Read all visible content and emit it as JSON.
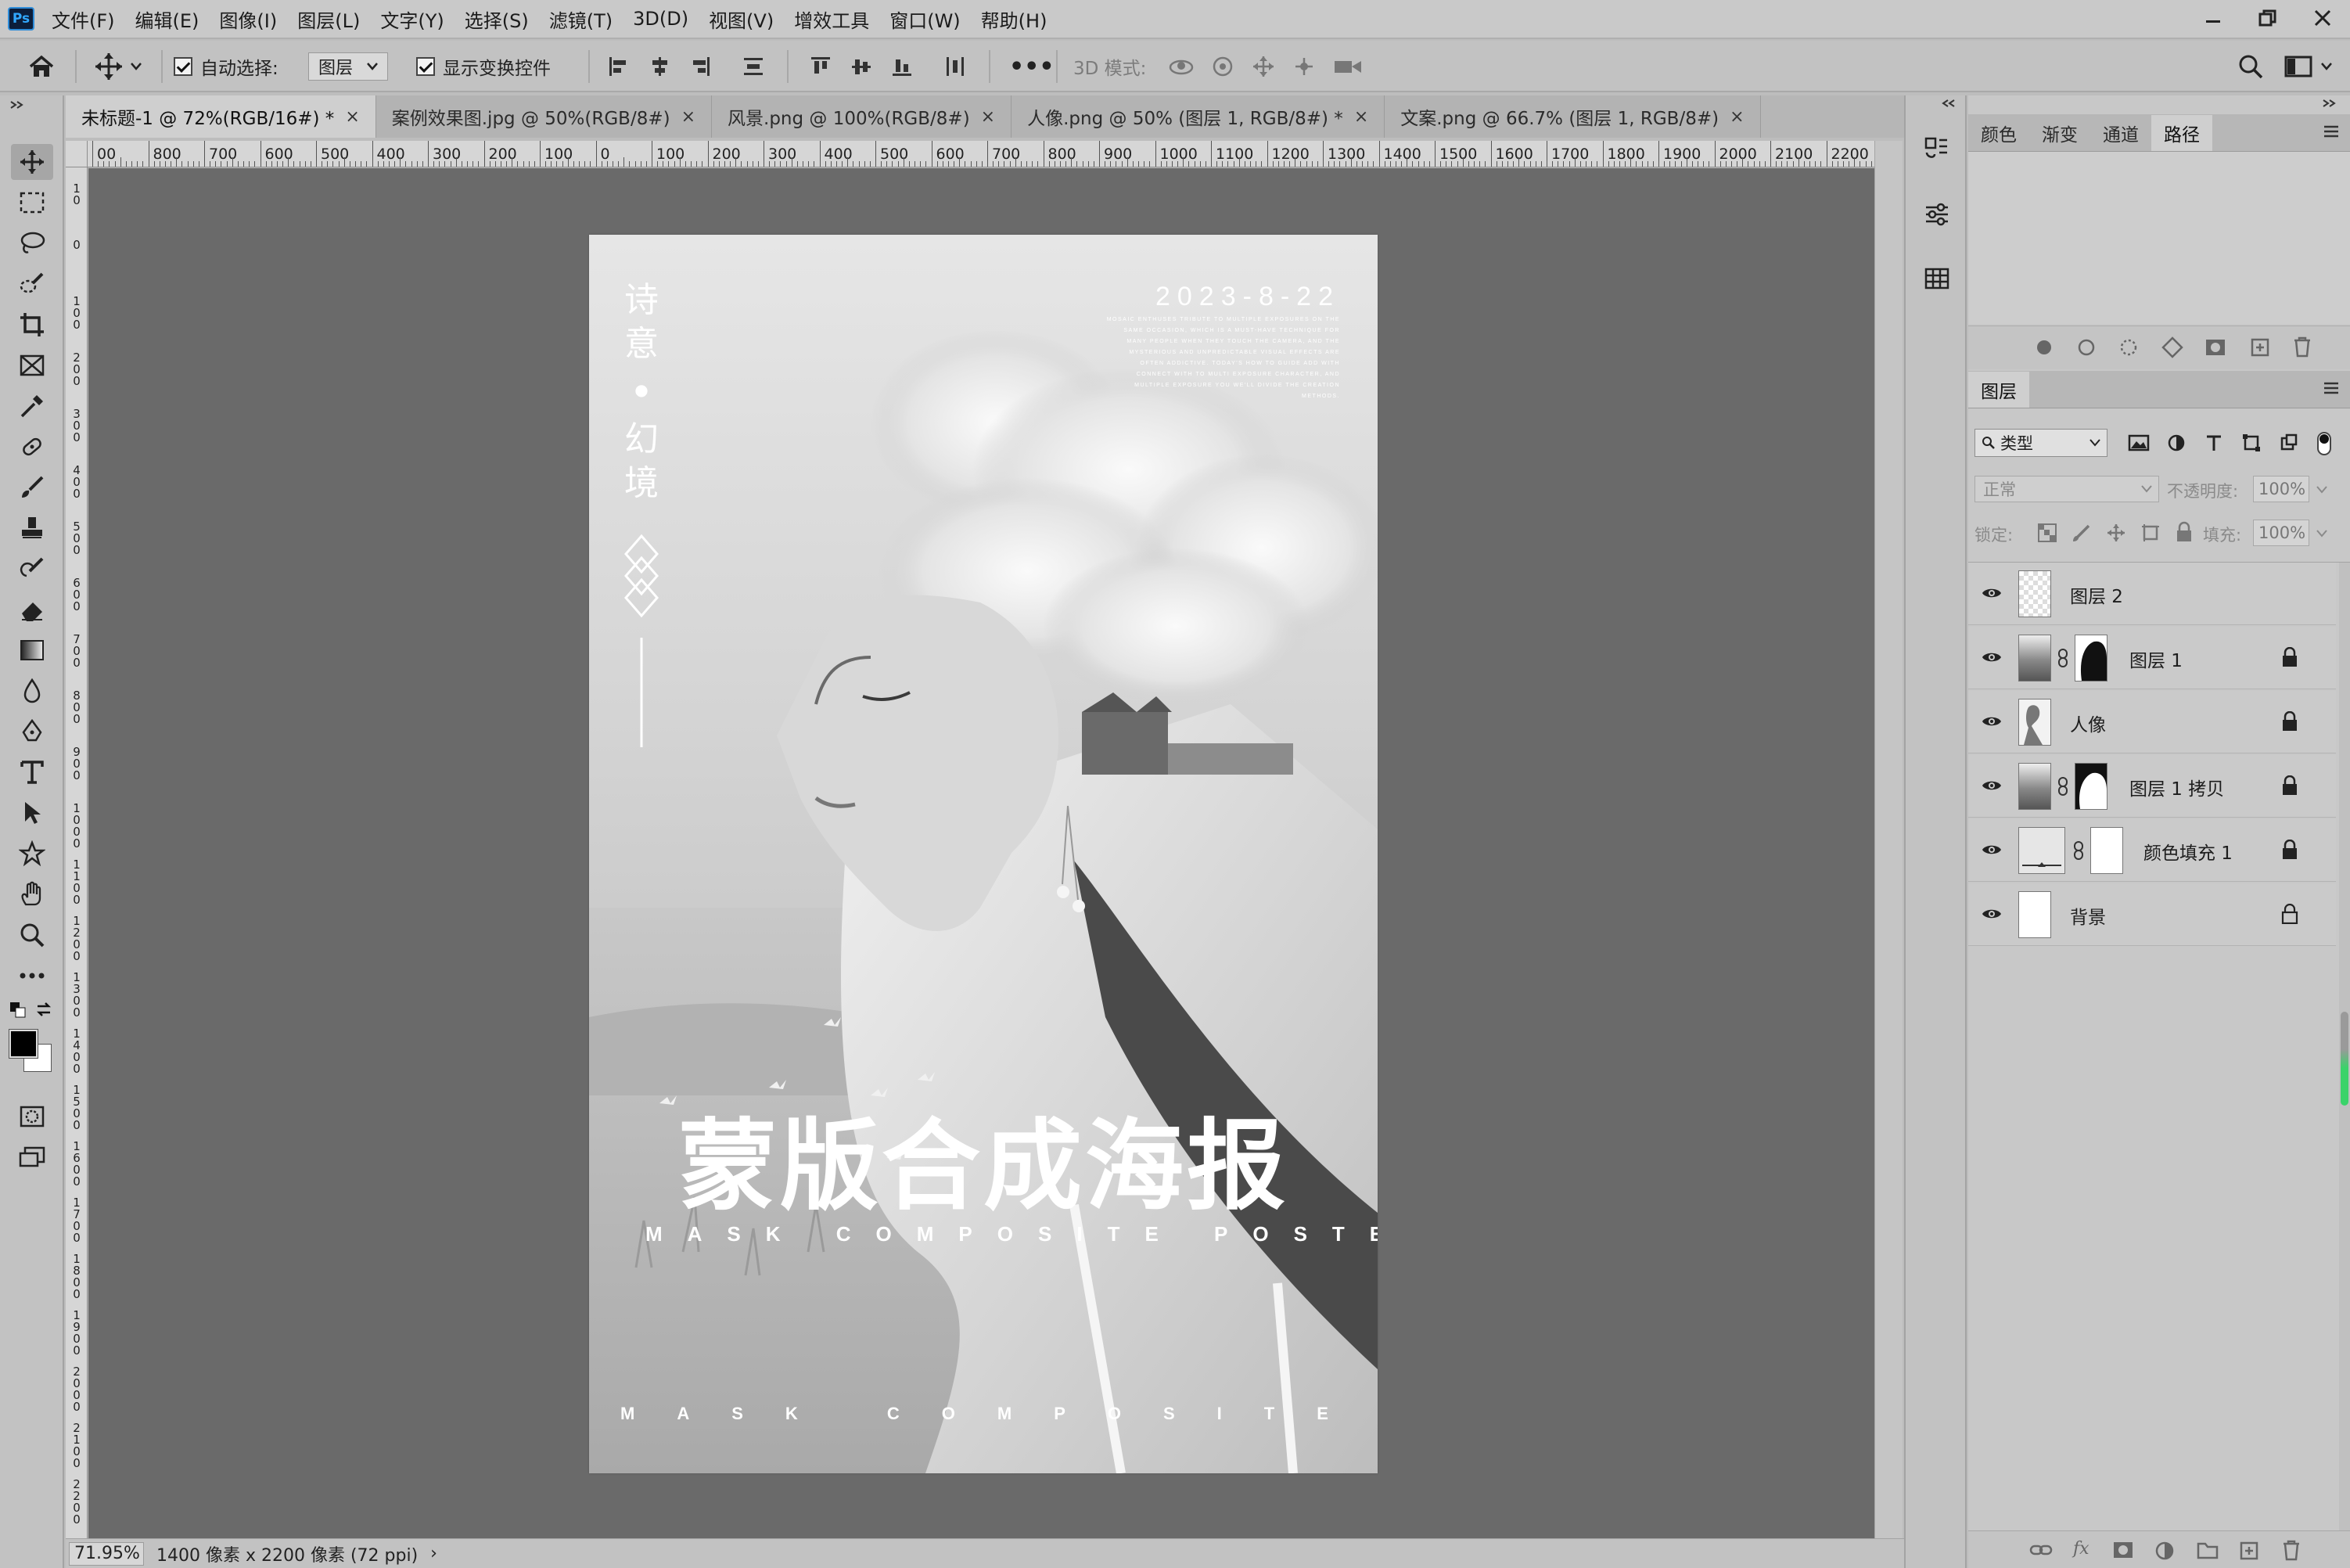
{
  "app": {
    "logo": "Ps",
    "colors": {
      "chrome": "#c2c2c2",
      "canvas": "#6a6a6a",
      "accent": "#31a8ff"
    }
  },
  "menu": [
    "文件(F)",
    "编辑(E)",
    "图像(I)",
    "图层(L)",
    "文字(Y)",
    "选择(S)",
    "滤镜(T)",
    "3D(D)",
    "视图(V)",
    "增效工具",
    "窗口(W)",
    "帮助(H)"
  ],
  "options": {
    "auto_select_label": "自动选择:",
    "auto_select_value": "图层",
    "show_transform_label": "显示变换控件",
    "three_d_mode_label": "3D 模式:",
    "more": "•••"
  },
  "tabs": [
    {
      "label": "未标题-1 @ 72%(RGB/16#) *",
      "active": true
    },
    {
      "label": "案例效果图.jpg @ 50%(RGB/8#)",
      "active": false
    },
    {
      "label": "风景.png @ 100%(RGB/8#)",
      "active": false
    },
    {
      "label": "人像.png @ 50% (图层 1, RGB/8#) *",
      "active": false
    },
    {
      "label": "文案.png @ 66.7% (图层 1, RGB/8#)",
      "active": false
    }
  ],
  "tab_close": "×",
  "ruler": {
    "h_labels": [
      "00",
      "800",
      "700",
      "600",
      "500",
      "400",
      "300",
      "200",
      "100",
      "0",
      "100",
      "200",
      "300",
      "400",
      "500",
      "600",
      "700",
      "800",
      "900",
      "1000",
      "1100",
      "1200",
      "1300",
      "1400",
      "1500",
      "1600",
      "1700",
      "1800",
      "1900",
      "2000",
      "2100",
      "2200"
    ],
    "v_labels": [
      "10",
      "0",
      "100",
      "200",
      "300",
      "400",
      "500",
      "600",
      "700",
      "800",
      "900",
      "1000",
      "1100",
      "1200",
      "1300",
      "1400",
      "1500",
      "1600",
      "1700",
      "1800",
      "1900",
      "2000",
      "2100",
      "2200"
    ]
  },
  "poster": {
    "side_title_1": "诗意",
    "side_dot": "●",
    "side_title_2": "幻境",
    "date": "2023-8-22",
    "small_text": "MOSAIC ENTHUSES TRIBUTE TO MULTIPLE EXPOSURES ON THE SAME OCCASION, WHICH IS A MUST-HAVE TECHNIQUE FOR MANY PEOPLE WHEN THEY TOUCH THE CAMERA, AND THE MYSTERIOUS AND UNPREDICTABLE VISUAL EFFECTS ARE OFTEN ADDICTIVE. TODAY'S HOW TO GUIDE ADD WITH CONNECT WITH TO MULTI EXPOSURE CHARACTER, AND MULTIPLE EXPOSURE YOU WE'LL DIVIDE THE CREATION METHODS.",
    "main_title": "蒙版合成海报",
    "sub_title": "MASK COMPOSITE POSTER",
    "footer_text": "MASK COMPOSITE POSTER"
  },
  "status": {
    "zoom": "71.95%",
    "doc_info": "1400 像素 x 2200 像素 (72 ppi)",
    "arrow": "›"
  },
  "panels": {
    "top_tabs": [
      {
        "label": "颜色",
        "active": false
      },
      {
        "label": "渐变",
        "active": false
      },
      {
        "label": "通道",
        "active": false
      },
      {
        "label": "路径",
        "active": true
      }
    ],
    "layers_tab": "图层",
    "filter_kind": "类型",
    "blend_mode": "正常",
    "opacity_label": "不透明度:",
    "opacity_value": "100%",
    "lock_label": "锁定:",
    "fill_label": "填充:",
    "fill_value": "100%",
    "layers": [
      {
        "name": "图层 2",
        "thumb": "checker",
        "mask": false,
        "locked": false
      },
      {
        "name": "图层 1",
        "thumb": "photo",
        "mask": true,
        "locked": true
      },
      {
        "name": "人像",
        "thumb": "portrait",
        "mask": false,
        "locked": true
      },
      {
        "name": "图层 1 拷贝",
        "thumb": "photo",
        "mask": true,
        "locked": true
      },
      {
        "name": "颜色填充 1",
        "thumb": "fill",
        "mask": true,
        "locked": true
      },
      {
        "name": "背景",
        "thumb": "white",
        "mask": false,
        "locked": true
      }
    ],
    "bottom_fx": "fx"
  }
}
